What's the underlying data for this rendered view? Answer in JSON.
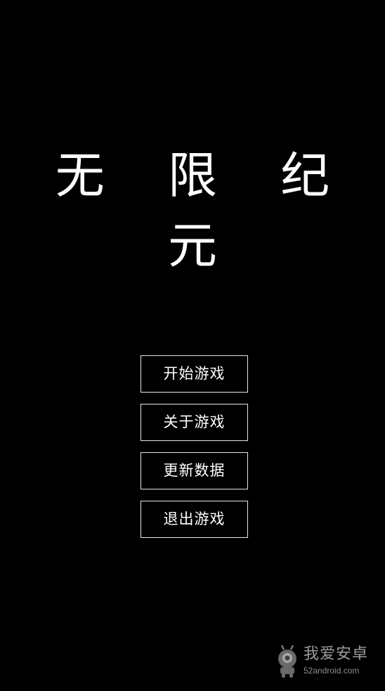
{
  "game": {
    "title": "无 限 纪 元"
  },
  "menu": {
    "items": [
      {
        "label": "开始游戏"
      },
      {
        "label": "关于游戏"
      },
      {
        "label": "更新数据"
      },
      {
        "label": "退出游戏"
      }
    ]
  },
  "watermark": {
    "brand": "我爱安卓",
    "url": "52android.com",
    "icon": "android-robot-icon"
  },
  "colors": {
    "background": "#000000",
    "text": "#ffffff",
    "button_border": "#e6e6e6"
  }
}
